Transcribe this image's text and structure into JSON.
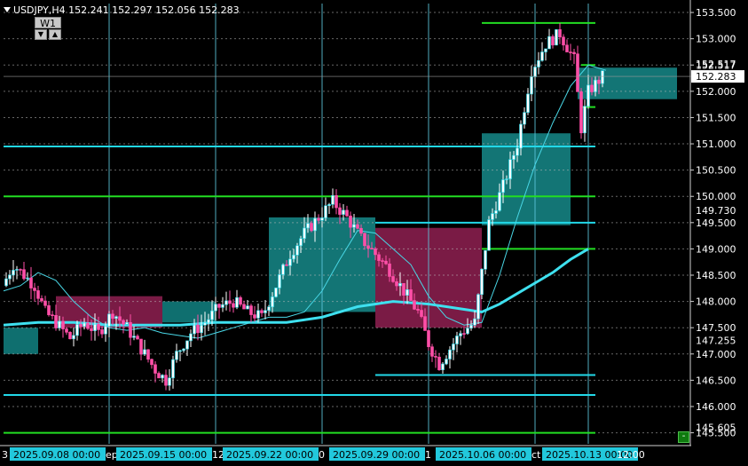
{
  "header": {
    "symbol_line": "USDJPY,H4  152.241 152.297 152.056 152.283",
    "timeframe_button": "W1"
  },
  "chart_data": {
    "type": "candlestick",
    "symbol": "USDJPY",
    "timeframe": "H4",
    "ohlc_display": {
      "open": 152.241,
      "high": 152.297,
      "low": 152.056,
      "close": 152.283
    },
    "y_range": [
      145.29,
      153.67
    ],
    "y_ticks": [
      145.5,
      146.0,
      146.5,
      147.0,
      147.5,
      148.0,
      148.5,
      149.0,
      149.5,
      150.0,
      150.5,
      151.0,
      151.5,
      152.0,
      152.5,
      153.0,
      153.5
    ],
    "y_tick_labels": [
      "145.500",
      "146.000",
      "146.500",
      "147.000",
      "147.500",
      "148.000",
      "148.500",
      "149.000",
      "149.500",
      "150.000",
      "150.500",
      "151.000",
      "151.500",
      "152.000",
      "152.517",
      "153.000",
      "153.500"
    ],
    "price_markers": [
      {
        "label": "145.605",
        "value": 145.605,
        "kind": "hidden"
      },
      {
        "label": "146.500",
        "value": 146.5,
        "kind": "level"
      },
      {
        "label": "147.255",
        "value": 147.255,
        "kind": "level"
      },
      {
        "label": "148.000",
        "value": 148.0,
        "kind": "level"
      },
      {
        "label": "149.730",
        "value": 149.73,
        "kind": "level"
      },
      {
        "label": "151.500",
        "value": 151.5,
        "kind": "level"
      },
      {
        "label": "152.517",
        "value": 152.517,
        "kind": "level"
      }
    ],
    "current_price": {
      "label": "152.283",
      "value": 152.283
    },
    "x_labels": [
      {
        "text": "2025.09.08 00:00",
        "bar": 0
      },
      {
        "text": "2025.09.15 00:00",
        "bar": 30
      },
      {
        "text": "2025.09.22 00:00",
        "bar": 60
      },
      {
        "text": "2025.09.29 00:00",
        "bar": 90
      },
      {
        "text": "2025.10.06 00:00",
        "bar": 120
      },
      {
        "text": "2025.10.13 00:00",
        "bar": 150
      },
      {
        "text": "12:00",
        "bar": 163
      }
    ],
    "x_label_fragments": [
      {
        "text": "3",
        "bar": -15
      },
      {
        "text": "ep",
        "bar": 15
      },
      {
        "text": "12",
        "bar": 45
      },
      {
        "text": "0",
        "bar": 75
      },
      {
        "text": "1",
        "bar": 105
      },
      {
        "text": "ct",
        "bar": 135
      }
    ],
    "week_separators_bars": [
      -15,
      15,
      45,
      75,
      105,
      135,
      150
    ],
    "zones": [
      {
        "bar_from": -15,
        "bar_to": -5,
        "y_from": 147.0,
        "y_to": 147.5,
        "color": "#0f6f6f"
      },
      {
        "bar_from": 0,
        "bar_to": 30,
        "y_from": 147.5,
        "y_to": 148.1,
        "color": "#7a1b45"
      },
      {
        "bar_from": 30,
        "bar_to": 45,
        "y_from": 147.6,
        "y_to": 148.0,
        "color": "#0f6f6f"
      },
      {
        "bar_from": 60,
        "bar_to": 90,
        "y_from": 147.8,
        "y_to": 149.6,
        "color": "#137575"
      },
      {
        "bar_from": 90,
        "bar_to": 120,
        "y_from": 147.5,
        "y_to": 149.4,
        "color": "#7a1b45"
      },
      {
        "bar_from": 120,
        "bar_to": 145,
        "y_from": 149.45,
        "y_to": 151.2,
        "color": "#137575"
      },
      {
        "bar_from": 147,
        "bar_to": 175,
        "y_from": 151.85,
        "y_to": 152.45,
        "color": "#137575"
      }
    ],
    "horizontal_lines": [
      {
        "y": 145.5,
        "bar_from": -15,
        "bar_to": 152,
        "color": "#22dd22",
        "width": 2
      },
      {
        "y": 146.22,
        "bar_from": -15,
        "bar_to": 152,
        "color": "#22d8e8",
        "width": 2
      },
      {
        "y": 146.6,
        "bar_from": 90,
        "bar_to": 152,
        "color": "#22d8e8",
        "width": 2
      },
      {
        "y": 149.5,
        "bar_from": 90,
        "bar_to": 152,
        "color": "#22d8e8",
        "width": 2
      },
      {
        "y": 149.0,
        "bar_from": 120,
        "bar_to": 152,
        "color": "#22dd22",
        "width": 2
      },
      {
        "y": 150.0,
        "bar_from": -15,
        "bar_to": 152,
        "color": "#22dd22",
        "width": 2
      },
      {
        "y": 150.95,
        "bar_from": -15,
        "bar_to": 152,
        "color": "#22d8e8",
        "width": 2
      },
      {
        "y": 151.7,
        "bar_from": 148,
        "bar_to": 152,
        "color": "#22dd22",
        "width": 2
      },
      {
        "y": 152.5,
        "bar_from": 148,
        "bar_to": 152,
        "color": "#22dd22",
        "width": 2
      },
      {
        "y": 153.3,
        "bar_from": 120,
        "bar_to": 152,
        "color": "#22dd22",
        "width": 2
      }
    ],
    "ma_fast": [
      [
        -15,
        148.2
      ],
      [
        -10,
        148.3
      ],
      [
        -5,
        148.55
      ],
      [
        0,
        148.4
      ],
      [
        5,
        148.0
      ],
      [
        10,
        147.7
      ],
      [
        15,
        147.5
      ],
      [
        20,
        147.45
      ],
      [
        25,
        147.5
      ],
      [
        30,
        147.4
      ],
      [
        35,
        147.35
      ],
      [
        40,
        147.3
      ],
      [
        45,
        147.4
      ],
      [
        50,
        147.5
      ],
      [
        55,
        147.6
      ],
      [
        60,
        147.7
      ],
      [
        65,
        147.7
      ],
      [
        70,
        147.8
      ],
      [
        75,
        148.2
      ],
      [
        80,
        148.8
      ],
      [
        85,
        149.35
      ],
      [
        90,
        149.3
      ],
      [
        95,
        149.0
      ],
      [
        100,
        148.7
      ],
      [
        105,
        148.1
      ],
      [
        110,
        147.7
      ],
      [
        115,
        147.55
      ],
      [
        120,
        147.6
      ],
      [
        125,
        148.5
      ],
      [
        130,
        149.6
      ],
      [
        135,
        150.6
      ],
      [
        140,
        151.4
      ],
      [
        145,
        152.1
      ],
      [
        150,
        152.5
      ],
      [
        155,
        152.4
      ]
    ],
    "ma_slow": [
      [
        -15,
        147.55
      ],
      [
        -5,
        147.6
      ],
      [
        5,
        147.6
      ],
      [
        15,
        147.55
      ],
      [
        25,
        147.55
      ],
      [
        35,
        147.55
      ],
      [
        45,
        147.6
      ],
      [
        55,
        147.6
      ],
      [
        65,
        147.6
      ],
      [
        75,
        147.7
      ],
      [
        85,
        147.9
      ],
      [
        95,
        148.0
      ],
      [
        105,
        147.95
      ],
      [
        115,
        147.85
      ],
      [
        120,
        147.8
      ],
      [
        125,
        147.95
      ],
      [
        130,
        148.15
      ],
      [
        135,
        148.35
      ],
      [
        140,
        148.55
      ],
      [
        145,
        148.8
      ],
      [
        150,
        149.0
      ]
    ],
    "candle_colors": {
      "up": "#ffffff",
      "down": "#ff4fa8",
      "up_border": "#22d8e8"
    }
  }
}
